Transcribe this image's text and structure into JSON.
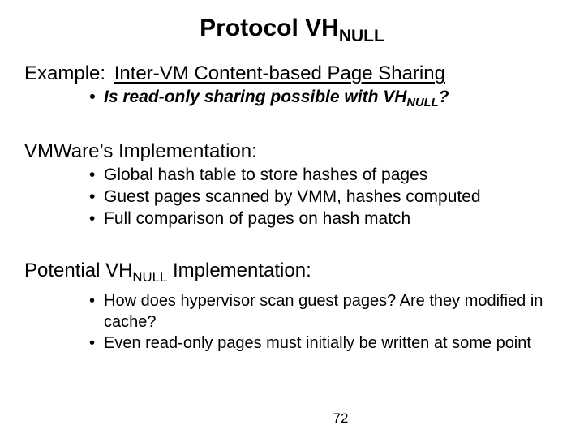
{
  "title": {
    "prefix": "Protocol VH",
    "sub": "NULL"
  },
  "example": {
    "label": "Example:",
    "underlined": "Inter-VM Content-based Page Sharing",
    "bullets": [
      {
        "prefix": "Is read-only sharing possible with VH",
        "sub": "NULL",
        "suffix": "?"
      }
    ]
  },
  "vmware": {
    "heading": "VMWare’s Implementation:",
    "bullets": [
      "Global hash table to store hashes of pages",
      "Guest pages scanned by VMM, hashes computed",
      "Full comparison of pages on hash match"
    ]
  },
  "potential": {
    "heading_prefix": "Potential VH",
    "heading_sub": "NULL",
    "heading_suffix": " Implementation:",
    "bullets": [
      "How does hypervisor scan guest pages?  Are they modified in cache?",
      "Even read-only pages must initially be written at some point"
    ]
  },
  "page_number": "72"
}
